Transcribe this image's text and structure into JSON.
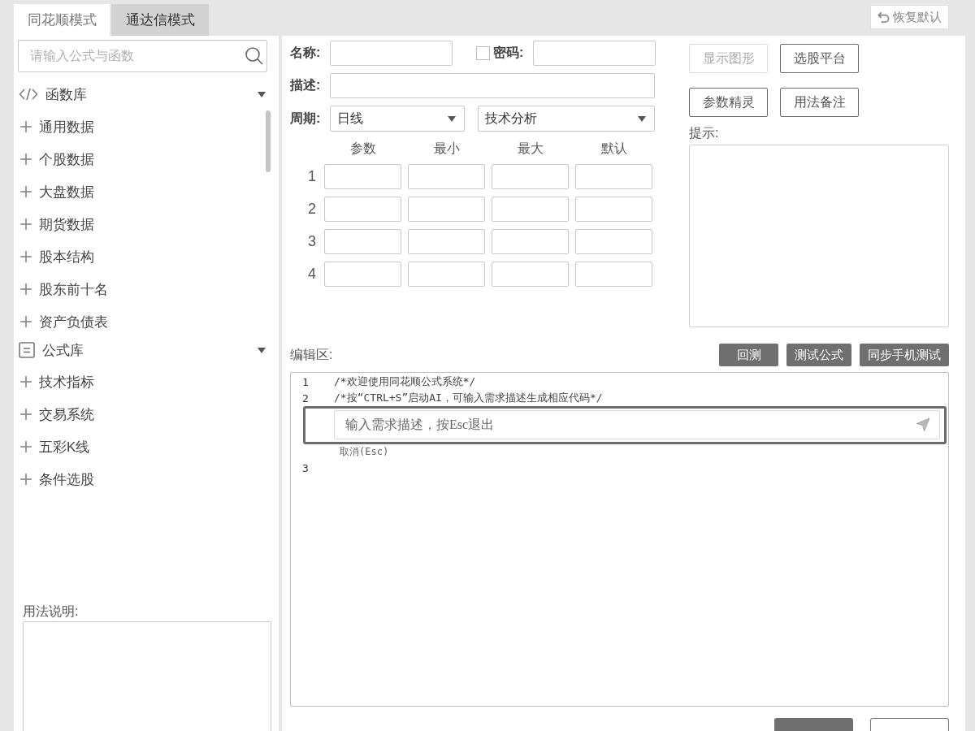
{
  "mode_tabs": [
    {
      "label": "同花顺模式",
      "selected": true
    },
    {
      "label": "通达信模式",
      "selected": false
    }
  ],
  "restore_button": {
    "label": "恢复默认"
  },
  "sidebar": {
    "search": {
      "placeholder": "请输入公式与函数"
    },
    "sections": [
      {
        "kind": "code",
        "title": "函数库",
        "expanded": true,
        "items": [
          {
            "label": "通用数据",
            "expanded": false
          },
          {
            "label": "个股数据",
            "expanded": false
          },
          {
            "label": "大盘数据",
            "expanded": false
          },
          {
            "label": "期货数据",
            "expanded": false
          },
          {
            "label": "股本结构",
            "expanded": false
          },
          {
            "label": "股东前十名",
            "expanded": false
          },
          {
            "label": "资产负债表",
            "expanded": false
          }
        ]
      },
      {
        "kind": "document",
        "title": "公式库",
        "expanded": true,
        "items": [
          {
            "label": "技术指标",
            "expanded": false
          },
          {
            "label": "交易系统",
            "expanded": false
          },
          {
            "label": "五彩K线",
            "expanded": false
          },
          {
            "label": "条件选股",
            "expanded": false
          }
        ]
      }
    ],
    "usage": {
      "label": "用法说明:"
    }
  },
  "form": {
    "name": {
      "label": "名称:"
    },
    "password": {
      "label": "密码:",
      "checked": false
    },
    "description": {
      "label": "描述:"
    },
    "period": {
      "label": "周期:",
      "value": "日线"
    },
    "category": {
      "value": "技术分析"
    },
    "params": {
      "columns": [
        "参数",
        "最小",
        "最大",
        "默认"
      ],
      "rows": [
        "1",
        "2",
        "3",
        "4"
      ]
    }
  },
  "tool_buttons": [
    {
      "label": "显示图形",
      "disabled": true
    },
    {
      "label": "选股平台",
      "disabled": false
    },
    {
      "label": "参数精灵",
      "disabled": false
    },
    {
      "label": "用法备注",
      "disabled": false
    }
  ],
  "hint": {
    "label": "提示:"
  },
  "editor": {
    "label": "编辑区:",
    "actions": [
      "回测",
      "测试公式",
      "同步手机测试"
    ],
    "lines": [
      {
        "kind": "code",
        "number": "1",
        "text": "/*欢迎使用同花顺公式系统*/"
      },
      {
        "kind": "code",
        "number": "2",
        "text": "/*按“CTRL+S”启动AI，可输入需求描述生成相应代码*/"
      },
      {
        "kind": "ai_prompt",
        "placeholder": "输入需求描述，按Esc退出",
        "cancel": "取消(Esc)"
      },
      {
        "kind": "code",
        "number": "3"
      }
    ]
  },
  "footer_buttons": [
    {
      "kind": "primary"
    },
    {
      "kind": "secondary"
    }
  ]
}
